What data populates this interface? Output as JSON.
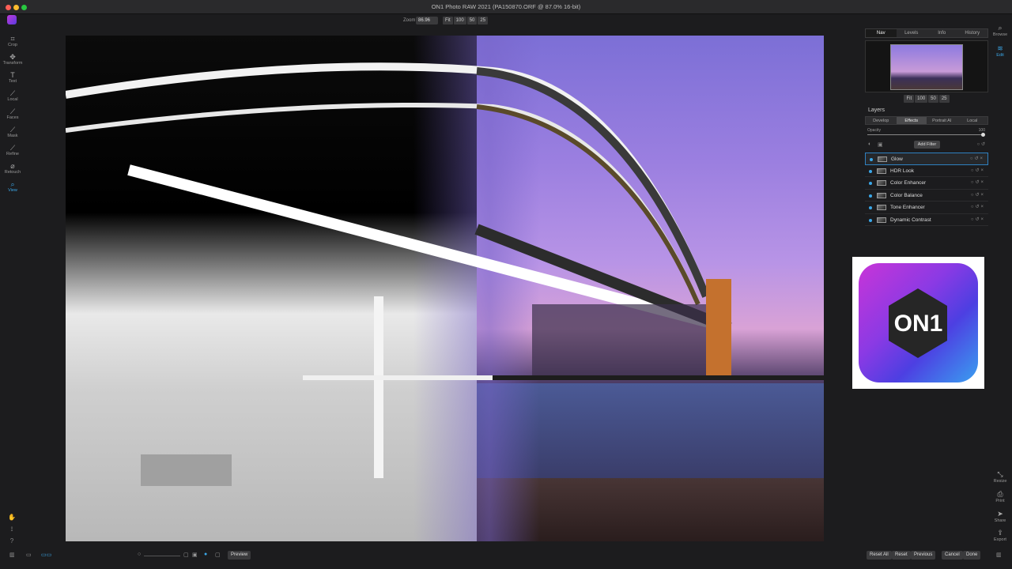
{
  "window": {
    "title": "ON1 Photo RAW 2021 (PA150870.ORF @ 87.0% 16-bit)"
  },
  "colors": {
    "accent": "#3aa7e8",
    "close": "#ff5f57",
    "minimize": "#febc2e",
    "zoom": "#28c840"
  },
  "zoom": {
    "label": "Zoom",
    "value": "86.96",
    "presets": [
      "Fit",
      "100",
      "50",
      "25"
    ]
  },
  "left_tools": [
    {
      "label": "Crop",
      "icon": "crop-icon"
    },
    {
      "label": "Transform",
      "icon": "transform-icon"
    },
    {
      "label": "Text",
      "icon": "text-icon"
    },
    {
      "label": "Local",
      "icon": "brush-icon"
    },
    {
      "label": "Faces",
      "icon": "faces-icon"
    },
    {
      "label": "Mask",
      "icon": "mask-icon"
    },
    {
      "label": "Refine",
      "icon": "refine-icon"
    },
    {
      "label": "Retouch",
      "icon": "retouch-icon"
    },
    {
      "label": "View",
      "icon": "view-icon",
      "active": true
    }
  ],
  "right_panel": {
    "tabs": [
      "Nav",
      "Levels",
      "Info",
      "History"
    ],
    "nav_presets": [
      "Fit",
      "100",
      "50",
      "25"
    ],
    "layers_title": "Layers",
    "layer_tabs": [
      "Develop",
      "Effects",
      "Portrait AI",
      "Local"
    ],
    "opacity_label": "Opacity",
    "opacity_value": "100",
    "add_filter_label": "Add Filter",
    "filters": [
      "Glow",
      "HDR Look",
      "Color Enhancer",
      "Color Balance",
      "Tone Enhancer",
      "Dynamic Contrast"
    ]
  },
  "right_strip": {
    "top": [
      {
        "label": "Browse",
        "icon": "browse-icon"
      },
      {
        "label": "Edit",
        "icon": "edit-icon"
      }
    ],
    "bottom": [
      {
        "label": "Resize",
        "icon": "resize-icon"
      },
      {
        "label": "Print",
        "icon": "print-icon"
      },
      {
        "label": "Share",
        "icon": "share-icon"
      },
      {
        "label": "Export",
        "icon": "export-icon"
      }
    ]
  },
  "logo": {
    "text": "ON1"
  },
  "bottom_bar": {
    "preview_label": "Preview",
    "reset_all_label": "Reset All",
    "reset_label": "Reset",
    "previous_label": "Previous",
    "cancel_label": "Cancel",
    "done_label": "Done"
  }
}
